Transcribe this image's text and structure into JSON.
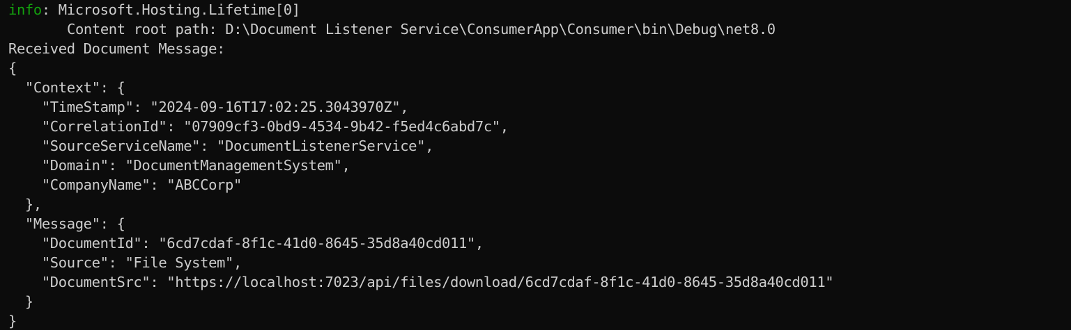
{
  "colors": {
    "background": "#0c0c0c",
    "foreground": "#cccccc",
    "info_level": "#13a10e"
  },
  "log": {
    "level": "info",
    "separator": ": ",
    "category": "Microsoft.Hosting.Lifetime[0]",
    "content_root": "Content root path: D:\\Document Listener Service\\ConsumerApp\\Consumer\\bin\\Debug\\net8.0"
  },
  "output": {
    "received_label": "Received Document Message:",
    "json_lines": [
      "{",
      "  \"Context\": {",
      "    \"TimeStamp\": \"2024-09-16T17:02:25.3043970Z\",",
      "    \"CorrelationId\": \"07909cf3-0bd9-4534-9b42-f5ed4c6abd7c\",",
      "    \"SourceServiceName\": \"DocumentListenerService\",",
      "    \"Domain\": \"DocumentManagementSystem\",",
      "    \"CompanyName\": \"ABCCorp\"",
      "  },",
      "  \"Message\": {",
      "    \"DocumentId\": \"6cd7cdaf-8f1c-41d0-8645-35d8a40cd011\",",
      "    \"Source\": \"File System\",",
      "    \"DocumentSrc\": \"https://localhost:7023/api/files/download/6cd7cdaf-8f1c-41d0-8645-35d8a40cd011\"",
      "  }",
      "}"
    ]
  }
}
